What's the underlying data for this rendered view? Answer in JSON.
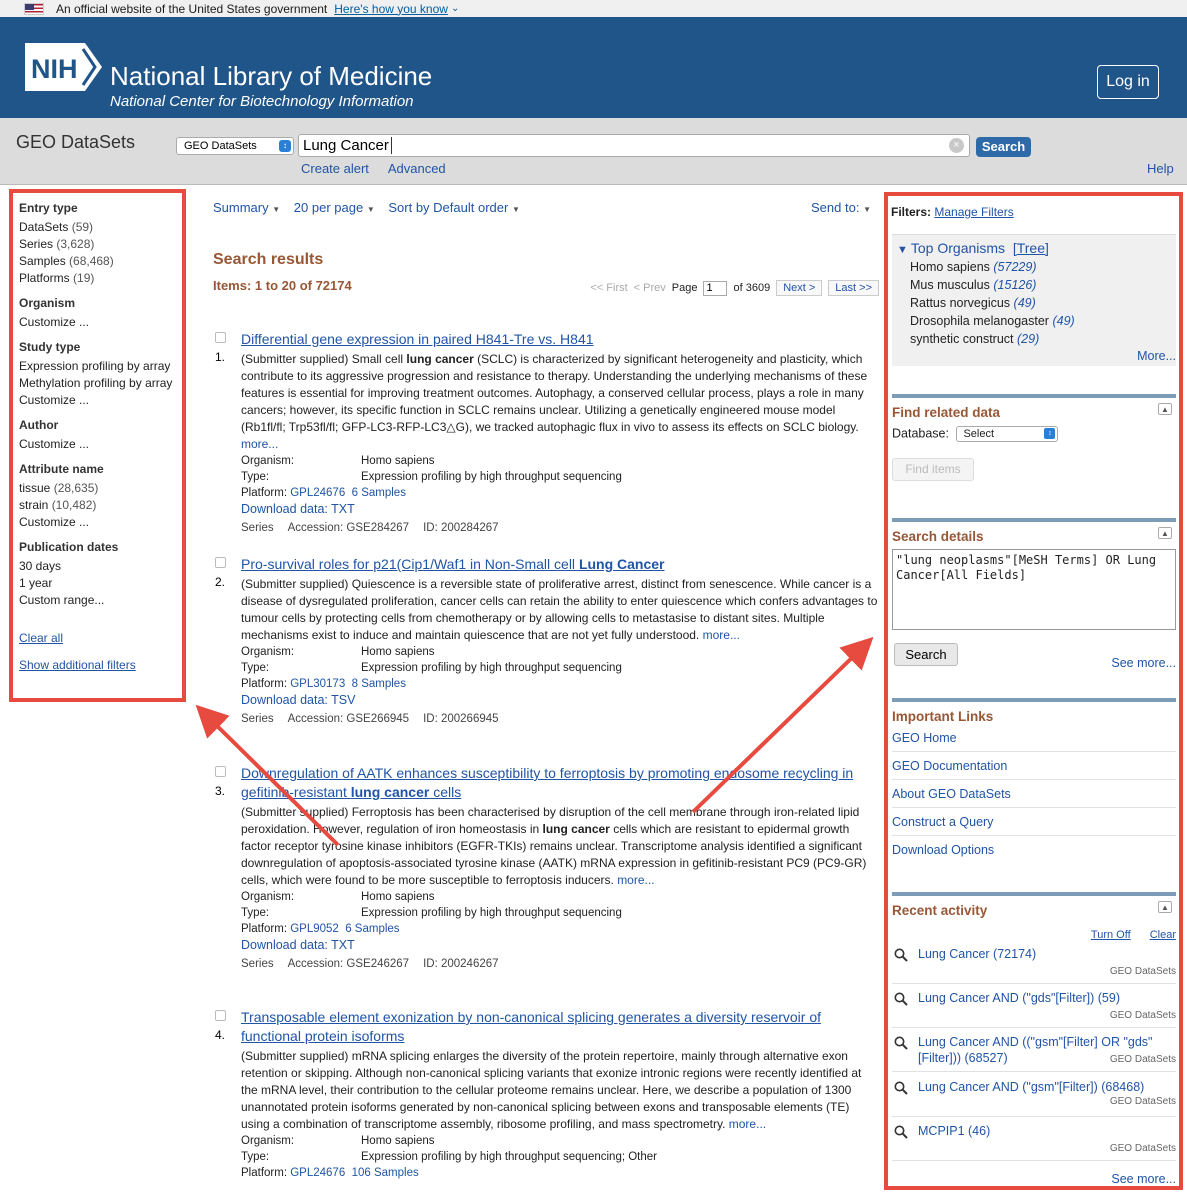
{
  "gov_banner": {
    "text": "An official website of the United States government",
    "link": "Here's how you know"
  },
  "header": {
    "logo_text": "NIH",
    "title": "National Library of Medicine",
    "subtitle": "National Center for Biotechnology Information",
    "login": "Log in"
  },
  "searchbar": {
    "db_name": "GEO DataSets",
    "db_select": "GEO DataSets",
    "query": "Lung Cancer",
    "search_label": "Search",
    "create_alert": "Create alert",
    "advanced": "Advanced",
    "help": "Help"
  },
  "left": {
    "entry_type": {
      "heading": "Entry type",
      "items": [
        {
          "label": "DataSets",
          "count": "(59)"
        },
        {
          "label": "Series",
          "count": "(3,628)"
        },
        {
          "label": "Samples",
          "count": "(68,468)"
        },
        {
          "label": "Platforms",
          "count": "(19)"
        }
      ]
    },
    "organism": {
      "heading": "Organism",
      "customize": "Customize ..."
    },
    "study_type": {
      "heading": "Study type",
      "items": [
        "Expression profiling by array",
        "Methylation profiling by array"
      ],
      "customize": "Customize ..."
    },
    "author": {
      "heading": "Author",
      "customize": "Customize ..."
    },
    "attribute": {
      "heading": "Attribute name",
      "items": [
        {
          "label": "tissue",
          "count": "(28,635)"
        },
        {
          "label": "strain",
          "count": "(10,482)"
        }
      ],
      "customize": "Customize ..."
    },
    "pubdates": {
      "heading": "Publication dates",
      "items": [
        "30 days",
        "1 year",
        "Custom range..."
      ]
    },
    "clear_all": "Clear all",
    "show_filters": "Show additional filters"
  },
  "toolbar": {
    "summary": "Summary",
    "per_page": "20 per page",
    "sort": "Sort by Default order",
    "send_to": "Send to:"
  },
  "results_header": "Search results",
  "items_count": "Items: 1 to 20 of 72174",
  "pager": {
    "first": "<< First",
    "prev": "< Prev",
    "page_label": "Page",
    "page": "1",
    "of": "of 3609",
    "next": "Next >",
    "last": "Last >>"
  },
  "results": [
    {
      "num": "1.",
      "title": "Differential gene expression in paired H841-Tre vs. H841",
      "desc_pre": "(Submitter supplied) Small cell ",
      "desc_bold": "lung cancer",
      "desc_post": " (SCLC) is characterized by significant heterogeneity and plasticity, which contribute to its aggressive progression and resistance to therapy. Understanding the underlying mechanisms of these features is essential for improving treatment outcomes. Autophagy, a conserved cellular process, plays a role in many cancers; however, its specific function in SCLC remains unclear. Utilizing a genetically engineered mouse model (Rb1fl/fl; Trp53fl/fl; GFP-LC3-RFP-LC3△G), we tracked autophagic flux in vivo to assess its effects on SCLC biology. ",
      "more": "more...",
      "org_label": "Organism:",
      "organism": "Homo sapiens",
      "type_label": "Type:",
      "type": "Expression profiling by high throughput sequencing",
      "platform_label": "Platform:",
      "platform": "GPL24676",
      "samples": "6 Samples",
      "download": "Download data: TXT",
      "kind": "Series",
      "accession": "Accession: GSE284267",
      "id": "ID: 200284267"
    },
    {
      "num": "2.",
      "title_pre": "Pro-survival roles for p21(Cip1/Waf1 in Non-Small cell ",
      "title_bold": "Lung Cancer",
      "desc": "(Submitter supplied) Quiescence is a reversible state of proliferative arrest, distinct from senescence. While cancer is a disease of dysregulated proliferation, cancer cells can retain the ability to enter quiescence which confers advantages to tumour cells by protecting cells from chemotherapy or by allowing cells to metastasise to distant sites. Multiple mechanisms exist to induce and maintain quiescence that are not yet fully understood. ",
      "more": "more...",
      "org_label": "Organism:",
      "organism": "Homo sapiens",
      "type_label": "Type:",
      "type": "Expression profiling by high throughput sequencing",
      "platform_label": "Platform:",
      "platform": "GPL30173",
      "samples": "8 Samples",
      "download": "Download data: TSV",
      "kind": "Series",
      "accession": "Accession: GSE266945",
      "id": "ID: 200266945"
    },
    {
      "num": "3.",
      "title_pre": "Downregulation of AATK enhances susceptibility to ferroptosis by promoting endosome recycling in gefitinib-resistant ",
      "title_bold": "lung cancer",
      "title_post": " cells",
      "desc_pre": "(Submitter supplied) Ferroptosis has been characterised by disruption of the cell membrane through iron-related lipid peroxidation. However, regulation of iron homeostasis in ",
      "desc_bold": "lung cancer",
      "desc_post": " cells which are resistant to epidermal growth factor receptor tyrosine kinase inhibitors (EGFR-TKIs) remains unclear. Transcriptome analysis identified a significant downregulation of apoptosis-associated tyrosine kinase (AATK) mRNA expression in gefitinib-resistant PC9 (PC9-GR) cells, which were found to be more susceptible to ferroptosis inducers. ",
      "more": "more...",
      "org_label": "Organism:",
      "organism": "Homo sapiens",
      "type_label": "Type:",
      "type": "Expression profiling by high throughput sequencing",
      "platform_label": "Platform:",
      "platform": "GPL9052",
      "samples": "6 Samples",
      "download": "Download data: TXT",
      "kind": "Series",
      "accession": "Accession: GSE246267",
      "id": "ID: 200246267"
    },
    {
      "num": "4.",
      "title": "Transposable element exonization by non-canonical splicing generates a diversity reservoir of functional protein isoforms",
      "desc": "(Submitter supplied) mRNA splicing enlarges the diversity of the protein repertoire, mainly through alternative exon retention or skipping. Although non-canonical splicing variants that exonize intronic regions were recently identified at the mRNA level, their contribution to the cellular proteome remains unclear. Here, we describe a population of 1300 unannotated protein isoforms generated by non-canonical splicing between exons and transposable elements (TE) using a combination of transcriptome assembly, ribosome profiling, and mass spectrometry. ",
      "more": "more...",
      "org_label": "Organism:",
      "organism": "Homo sapiens",
      "type_label": "Type:",
      "type": "Expression profiling by high throughput sequencing; Other",
      "platform_label": "Platform:",
      "platform": "GPL24676",
      "samples": "106 Samples"
    }
  ],
  "right": {
    "filters_label": "Filters:",
    "manage_filters": "Manage Filters",
    "top_organisms": {
      "heading": "Top Organisms",
      "tree": "[Tree]",
      "items": [
        {
          "name": "Homo sapiens",
          "count": "(57229)"
        },
        {
          "name": "Mus musculus",
          "count": "(15126)"
        },
        {
          "name": "Rattus norvegicus",
          "count": "(49)"
        },
        {
          "name": "Drosophila melanogaster",
          "count": "(49)"
        },
        {
          "name": "synthetic construct",
          "count": "(29)"
        }
      ],
      "more": "More..."
    },
    "find_related": {
      "heading": "Find related data",
      "db_label": "Database:",
      "db_value": "Select",
      "find_items": "Find items"
    },
    "search_details": {
      "heading": "Search details",
      "query": "\"lung neoplasms\"[MeSH Terms] OR Lung Cancer[All Fields]",
      "search": "Search",
      "see_more": "See more..."
    },
    "important_links": {
      "heading": "Important Links",
      "items": [
        "GEO Home",
        "GEO Documentation",
        "About GEO DataSets",
        "Construct a Query",
        "Download Options"
      ]
    },
    "recent": {
      "heading": "Recent activity",
      "turn_off": "Turn Off",
      "clear": "Clear",
      "items": [
        {
          "q": "Lung Cancer (72174)",
          "src": "GEO DataSets"
        },
        {
          "q": "Lung Cancer AND (\"gds\"[Filter]) (59)",
          "src": "GEO DataSets"
        },
        {
          "q": "Lung Cancer AND ((\"gsm\"[Filter] OR \"gds\"[Filter])) (68527)",
          "src": "GEO DataSets"
        },
        {
          "q": "Lung Cancer AND (\"gsm\"[Filter]) (68468)",
          "src": "GEO DataSets"
        },
        {
          "q": "MCPIP1 (46)",
          "src": "GEO DataSets"
        }
      ],
      "see_more": "See more..."
    }
  },
  "colors": {
    "header_bg": "#20558a",
    "accent_brown": "#985735",
    "link": "#2054a6",
    "annotation_red": "#e74a3f"
  }
}
